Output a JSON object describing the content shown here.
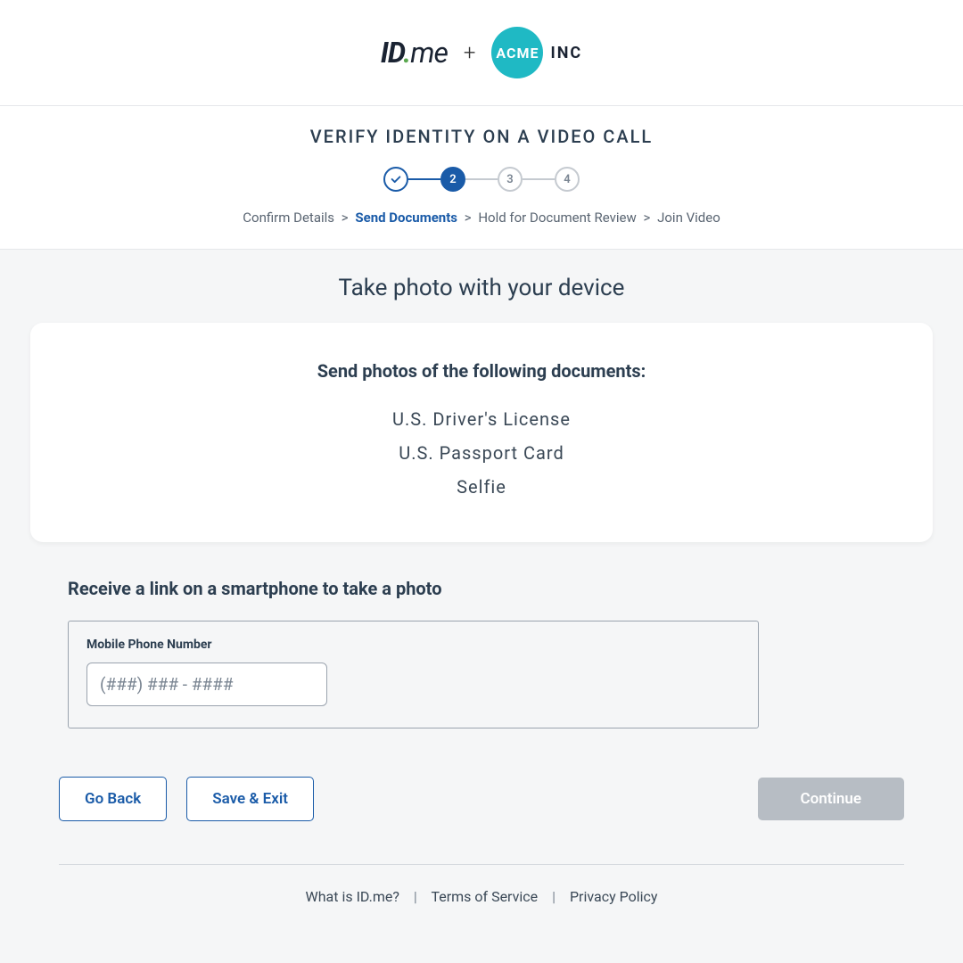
{
  "header": {
    "logo_idme_id": "ID",
    "logo_idme_me": "me",
    "plus": "+",
    "acme_circle": "ACME",
    "acme_inc": "INC"
  },
  "steps": {
    "title": "VERIFY IDENTITY ON A VIDEO CALL",
    "s2": "2",
    "s3": "3",
    "s4": "4"
  },
  "breadcrumb": {
    "step1": "Confirm Details",
    "step2": "Send Documents",
    "step3": "Hold for Document Review",
    "step4": "Join Video",
    "sep": ">"
  },
  "main": {
    "title": "Take photo with your device",
    "docs_heading": "Send photos of the following documents:",
    "docs": {
      "d1": "U.S. Driver's License",
      "d2": "U.S. Passport Card",
      "d3": "Selfie"
    }
  },
  "phone": {
    "heading": "Receive a link on a smartphone to take a photo",
    "label": "Mobile Phone Number",
    "placeholder": "(###) ### - ####"
  },
  "actions": {
    "go_back": "Go Back",
    "save_exit": "Save & Exit",
    "continue": "Continue"
  },
  "footer": {
    "what": "What is ID.me?",
    "tos": "Terms of Service",
    "privacy": "Privacy Policy",
    "sep": "|"
  }
}
